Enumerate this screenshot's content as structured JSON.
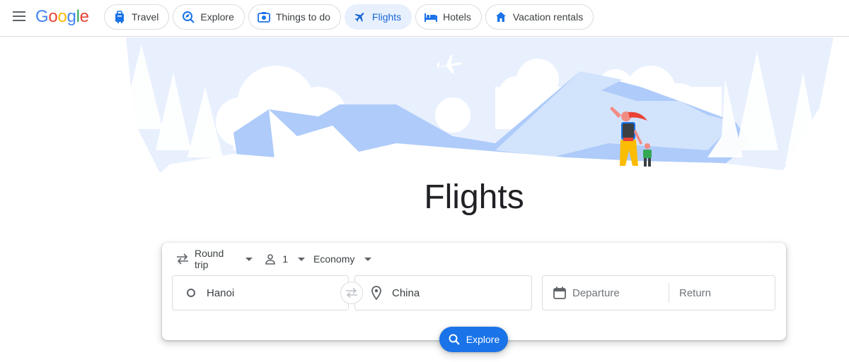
{
  "header": {
    "menu_icon": "hamburger-menu-icon",
    "logo": {
      "letters": [
        "G",
        "o",
        "o",
        "g",
        "l",
        "e"
      ],
      "colors": [
        "#4285f4",
        "#ea4335",
        "#fbbc05",
        "#4285f4",
        "#34a853",
        "#ea4335"
      ]
    },
    "chips": [
      {
        "label": "Travel",
        "icon": "suitcase-icon",
        "active": false
      },
      {
        "label": "Explore",
        "icon": "explore-icon",
        "active": false
      },
      {
        "label": "Things to do",
        "icon": "camera-icon",
        "active": false
      },
      {
        "label": "Flights",
        "icon": "airplane-icon",
        "active": true
      },
      {
        "label": "Hotels",
        "icon": "bed-icon",
        "active": false
      },
      {
        "label": "Vacation rentals",
        "icon": "house-icon",
        "active": false
      }
    ]
  },
  "main": {
    "title": "Flights"
  },
  "search": {
    "trip_type": "Round trip",
    "passengers": "1",
    "cabin_class": "Economy",
    "origin": "Hanoi",
    "destination": "China",
    "departure_placeholder": "Departure",
    "return_placeholder": "Return",
    "explore_label": "Explore"
  },
  "colors": {
    "accent": "#1a73e8",
    "active_chip_bg": "#e8f0fe",
    "active_chip_text": "#1967d2",
    "hero_sky": "#e8f0fe",
    "hero_mountain": "#aecbfa"
  }
}
